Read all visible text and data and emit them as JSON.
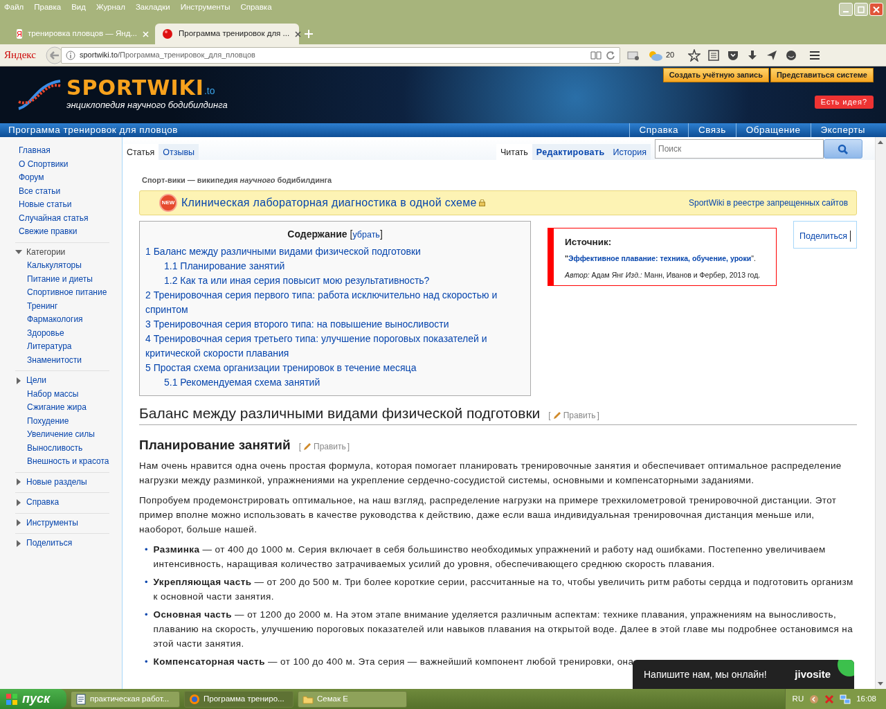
{
  "browser": {
    "menu": [
      "Файл",
      "Правка",
      "Вид",
      "Журнал",
      "Закладки",
      "Инструменты",
      "Справка"
    ],
    "tabs": [
      {
        "title": "тренировка пловцов — Янд...",
        "kind": "yandex",
        "icon_letter": "Я",
        "selected": false
      },
      {
        "title": "Программа тренировок для ...",
        "kind": "site",
        "selected": true
      }
    ],
    "brand": "Яндекс",
    "address": {
      "domain": "sportwiki.to",
      "path": "/Программа_тренировок_для_пловцов"
    },
    "weather": "20"
  },
  "site": {
    "logo": "SPORTWIKI",
    "tld": ".to",
    "tagline": "энциклопедия научного бодибилдинга",
    "account_links": [
      "Создать учётную запись",
      "Представиться системе"
    ],
    "idea_button": "Есть идея?",
    "page_title": "Программа тренировок для пловцов",
    "top_nav": [
      "Справка",
      "Связь",
      "Обращение",
      "Эксперты"
    ]
  },
  "sidebar": {
    "links": [
      "Главная",
      "О Спортвики",
      "Форум",
      "Все статьи",
      "Новые статьи",
      "Случайная статья",
      "Свежие правки"
    ],
    "sections": [
      {
        "title": "Категории",
        "expanded": true,
        "items": [
          "Калькуляторы",
          "Питание и диеты",
          "Спортивное питание",
          "Тренинг",
          "Фармакология",
          "Здоровье",
          "Литература",
          "Знаменитости"
        ]
      },
      {
        "title": "Цели",
        "expanded": false,
        "items": [
          "Набор массы",
          "Сжигание жира",
          "Похудение",
          "Увеличение силы",
          "Выносливость",
          "Внешность и красота"
        ]
      },
      {
        "title": "Новые разделы",
        "expanded": false
      },
      {
        "title": "Справка",
        "expanded": false
      },
      {
        "title": "Инструменты",
        "expanded": false
      },
      {
        "title": "Поделиться",
        "expanded": false
      }
    ]
  },
  "page_tabs": [
    {
      "label": "Статья",
      "selected": true
    },
    {
      "label": "Отзывы",
      "selected": false
    }
  ],
  "view_tabs": [
    {
      "label": "Читать",
      "selected": true,
      "kind": "plain"
    },
    {
      "label": "Редактировать",
      "selected": false,
      "kind": "bold"
    },
    {
      "label": "История",
      "selected": false,
      "kind": "plain"
    }
  ],
  "search": {
    "placeholder": "Поиск"
  },
  "site_motto": "Спорт-вики — википедия *научного* бодибилдинга",
  "banner": {
    "badge": "NEW",
    "text": "Клиническая лабораторная диагностика в одной схеме",
    "link": "SportWiki в реестре запрещенных сайтов"
  },
  "toc": {
    "title": "Содержание",
    "open": "[",
    "toggle": "убрать",
    "close": "]",
    "items": [
      {
        "text": "1 Баланс между различными видами физической подготовки",
        "children": [
          {
            "text": "1.1 Планирование занятий"
          },
          {
            "text": "1.2 Как та или иная серия повысит мою результативность?"
          }
        ]
      },
      {
        "text": "2 Тренировочная серия первого типа: работа исключительно над скоростью и спринтом"
      },
      {
        "text": "3 Тренировочная серия второго типа: на повышение выносливости"
      },
      {
        "text": "4 Тренировочная серия третьего типа: улучшение пороговых показателей и критической скорости плавания"
      },
      {
        "text": "5 Простая схема организации тренировок в течение месяца",
        "children": [
          {
            "text": "5.1 Рекомендуемая схема занятий"
          }
        ]
      }
    ]
  },
  "source": {
    "label": "Источник:",
    "quote_open": "\"",
    "book": "Эффективное плавание: техника, обучение, уроки",
    "quote_close": "\".",
    "credits": "*Автор:* Адам Янг *Изд.:* Манн, Иванов и Фербер, 2013 год."
  },
  "share": "Поделиться",
  "article": {
    "headings": [
      {
        "kind": "h2",
        "text": "Баланс между различными видами физической подготовки",
        "edit": [
          "[",
          "Править",
          "]"
        ]
      },
      {
        "kind": "h3",
        "text": "Планирование занятий",
        "edit": [
          "[",
          "Править",
          "]"
        ]
      }
    ],
    "marker": "•",
    "paragraphs": [
      "Нам очень нравится одна очень простая формула, которая помогает планировать тренировочные занятия и обеспечивает оптимальное распределение нагрузки между разминкой, упражнениями на укрепление сердечно-сосудистой системы, основными и компенсаторными заданиями.",
      "Попробуем продемонстрировать оптимальное, на наш взгляд, распределение нагрузки на примере трехкилометровой тренировочной дистанции. Этот пример вполне можно использовать в качестве руководства к действию, даже если ваша индивидуальная тренировочная дистанция меньше или, наоборот, больше нашей."
    ],
    "bullets": [
      "**Разминка** — от 400 до 1000 м. Серия включает в себя большинство необходимых упражнений и работу над ошибками. Постепенно увеличиваем интенсивность, наращивая количество затрачиваемых усилий до уровня, обеспечивающего среднюю скорость плавания.",
      "**Укрепляющая часть** — от 200 до 500 м. Три более короткие серии, рассчитанные на то, чтобы увеличить ритм работы сердца и подготовить организм к основной части занятия.",
      "**Основная часть** — от 1200 до 2000 м. На этом этапе внимание уделяется различным аспектам: технике плавания, упражнениям на выносливость, плаванию на скорость, улучшению пороговых показателей или навыков плавания на открытой воде. Далее в этой главе мы подробнее остановимся на этой части занятия.",
      "**Компенсаторная часть** — от 100 до 400 м. Эта серия — важнейший компонент любой тренировки, она"
    ]
  },
  "chat": {
    "text": "Напишите нам, мы онлайн!",
    "brand": "jivosite"
  },
  "taskbar": {
    "start": "пуск",
    "items": [
      {
        "label": "практическая работ...",
        "kind": "doc",
        "selected": false
      },
      {
        "label": "Программа трениро...",
        "kind": "browser",
        "selected": true
      },
      {
        "label": "Семак Е",
        "kind": "folder",
        "selected": false
      }
    ],
    "lang": "RU",
    "clock": "16:08"
  }
}
